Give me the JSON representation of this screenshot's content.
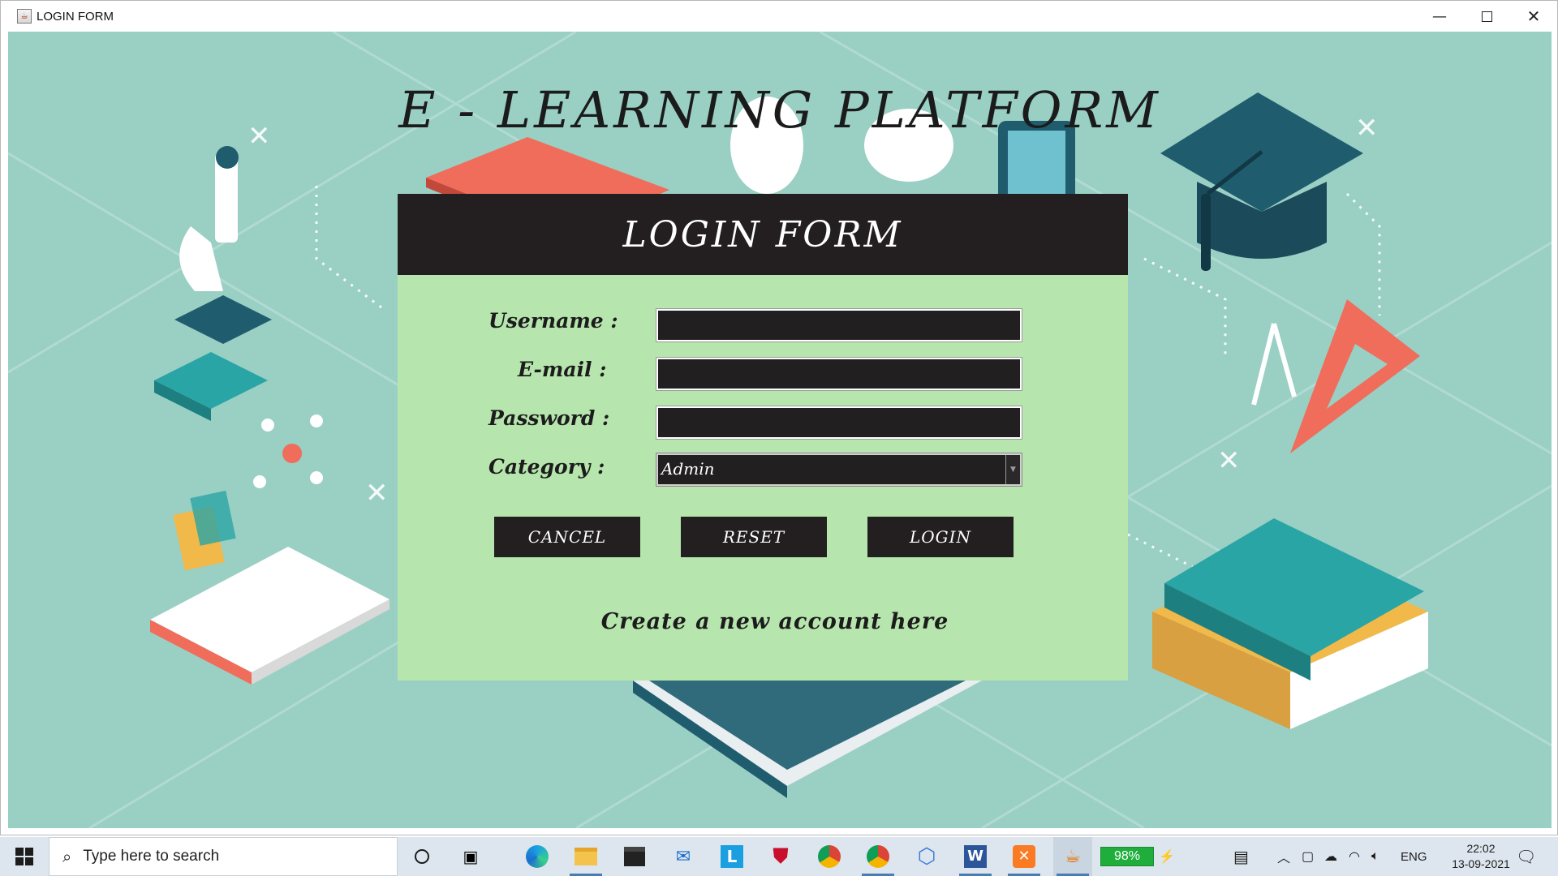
{
  "window": {
    "title": "LOGIN FORM",
    "min_glyph": "—",
    "close_glyph": "✕"
  },
  "page": {
    "heading": "E - LEARNING PLATFORM"
  },
  "form": {
    "header": "LOGIN FORM",
    "username_label": "Username :",
    "email_label": "E-mail :",
    "password_label": "Password :",
    "category_label": "Category :",
    "username_value": "",
    "email_value": "",
    "password_value": "",
    "category_value": "Admin",
    "cancel_label": "CANCEL",
    "reset_label": "RESET",
    "login_label": "LOGIN",
    "create_account_text": "Create a new account here"
  },
  "taskbar": {
    "search_placeholder": "Type here to search",
    "battery_text": "98%",
    "language": "ENG",
    "time": "22:02",
    "date": "13-09-2021",
    "icons": [
      "cortana-icon",
      "task-view-icon",
      "edge-icon",
      "file-explorer-icon",
      "store-icon",
      "mail-icon",
      "l-app-icon",
      "mcafee-icon",
      "chrome-icon",
      "chrome-profile-icon",
      "box-app-icon",
      "word-icon",
      "xampp-icon",
      "java-icon"
    ]
  },
  "colors": {
    "background": "#9acfc4",
    "panel": "#b6e5ad",
    "panel_header": "#231f20",
    "field": "#221f20"
  }
}
